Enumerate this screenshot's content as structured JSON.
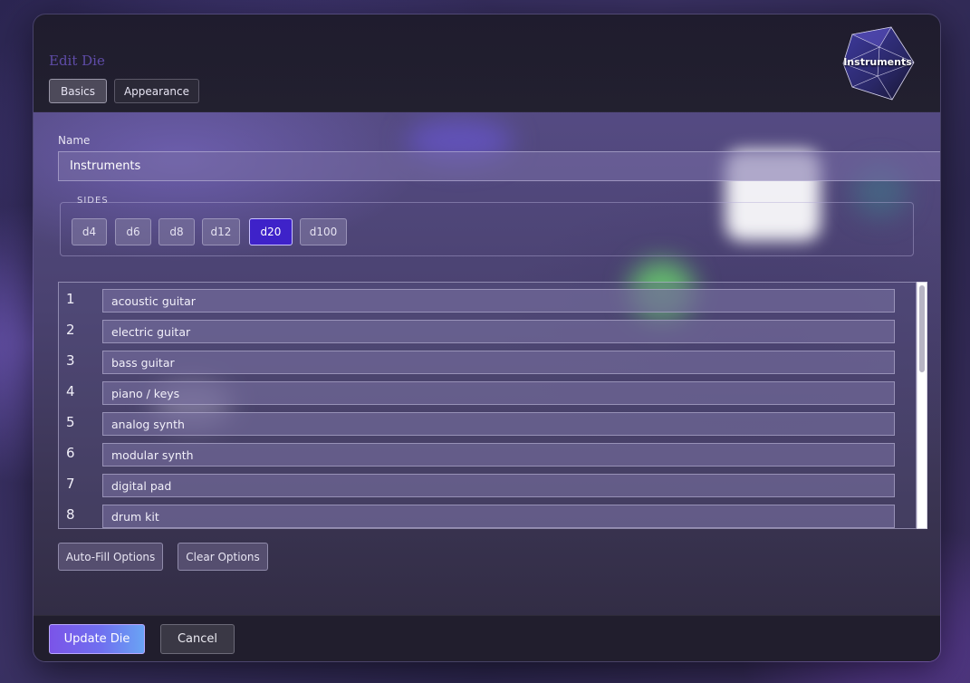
{
  "dialog": {
    "title": "Edit Die",
    "tabs": [
      {
        "label": "Basics",
        "active": true
      },
      {
        "label": "Appearance",
        "active": false
      }
    ],
    "logo_label": "Instruments"
  },
  "name_field": {
    "label": "Name",
    "value": "Instruments"
  },
  "sides": {
    "legend": "SIDES",
    "options": [
      "d4",
      "d6",
      "d8",
      "d12",
      "d20",
      "d100"
    ],
    "selected": "d20"
  },
  "options_list": {
    "rows": [
      {
        "number": "1",
        "value": "acoustic guitar"
      },
      {
        "number": "2",
        "value": "electric guitar"
      },
      {
        "number": "3",
        "value": "bass guitar"
      },
      {
        "number": "4",
        "value": "piano / keys"
      },
      {
        "number": "5",
        "value": "analog synth"
      },
      {
        "number": "6",
        "value": "modular synth"
      },
      {
        "number": "7",
        "value": "digital pad"
      },
      {
        "number": "8",
        "value": "drum kit"
      }
    ]
  },
  "actions": {
    "auto_fill_label": "Auto-Fill Options",
    "clear_label": "Clear Options"
  },
  "footer": {
    "update_label": "Update Die",
    "cancel_label": "Cancel"
  },
  "colors": {
    "accent": "#3e22c9",
    "title": "#5f4ca8",
    "update_gradient_start": "#7b54e8",
    "update_gradient_end": "#6aa4f4"
  }
}
